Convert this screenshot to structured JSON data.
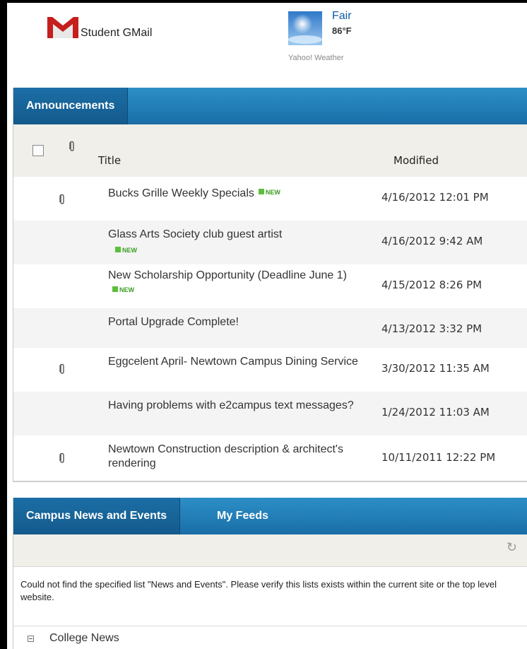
{
  "top": {
    "gmail_label": "Student GMail",
    "weather_condition": "Fair",
    "weather_temp": "86°F",
    "weather_source": "Yahoo! Weather"
  },
  "announcements": {
    "tab_label": "Announcements",
    "col_title": "Title",
    "col_modified": "Modified",
    "new_label": "NEW",
    "rows": [
      {
        "title": "Bucks Grille Weekly Specials",
        "modified": "4/16/2012 12:01 PM",
        "attachment": true,
        "is_new": true
      },
      {
        "title": "Glass Arts Society club guest artist",
        "modified": "4/16/2012 9:42 AM",
        "attachment": false,
        "is_new": true
      },
      {
        "title": "New Scholarship Opportunity (Deadline June 1)",
        "modified": "4/15/2012 8:26 PM",
        "attachment": false,
        "is_new": true
      },
      {
        "title": "Portal Upgrade Complete!",
        "modified": "4/13/2012 3:32 PM",
        "attachment": false,
        "is_new": false
      },
      {
        "title": "Eggcelent April- Newtown Campus Dining Service",
        "modified": "3/30/2012 11:35 AM",
        "attachment": true,
        "is_new": false
      },
      {
        "title": "Having problems with e2campus text messages?",
        "modified": "1/24/2012 11:03 AM",
        "attachment": false,
        "is_new": false
      },
      {
        "title": "Newtown Construction description & architect's rendering",
        "modified": "10/11/2011 12:22 PM",
        "attachment": true,
        "is_new": false
      }
    ]
  },
  "news": {
    "tab_campus": "Campus News and Events",
    "tab_feeds": "My Feeds",
    "message": "Could not find the specified list \"News and Events\". Please verify this lists exists within the current site or the top level website.",
    "section_label": "College News"
  },
  "colors": {
    "header_blue": "#1a6ea8",
    "new_green": "#3a9c23",
    "link_blue": "#0a5da8"
  }
}
